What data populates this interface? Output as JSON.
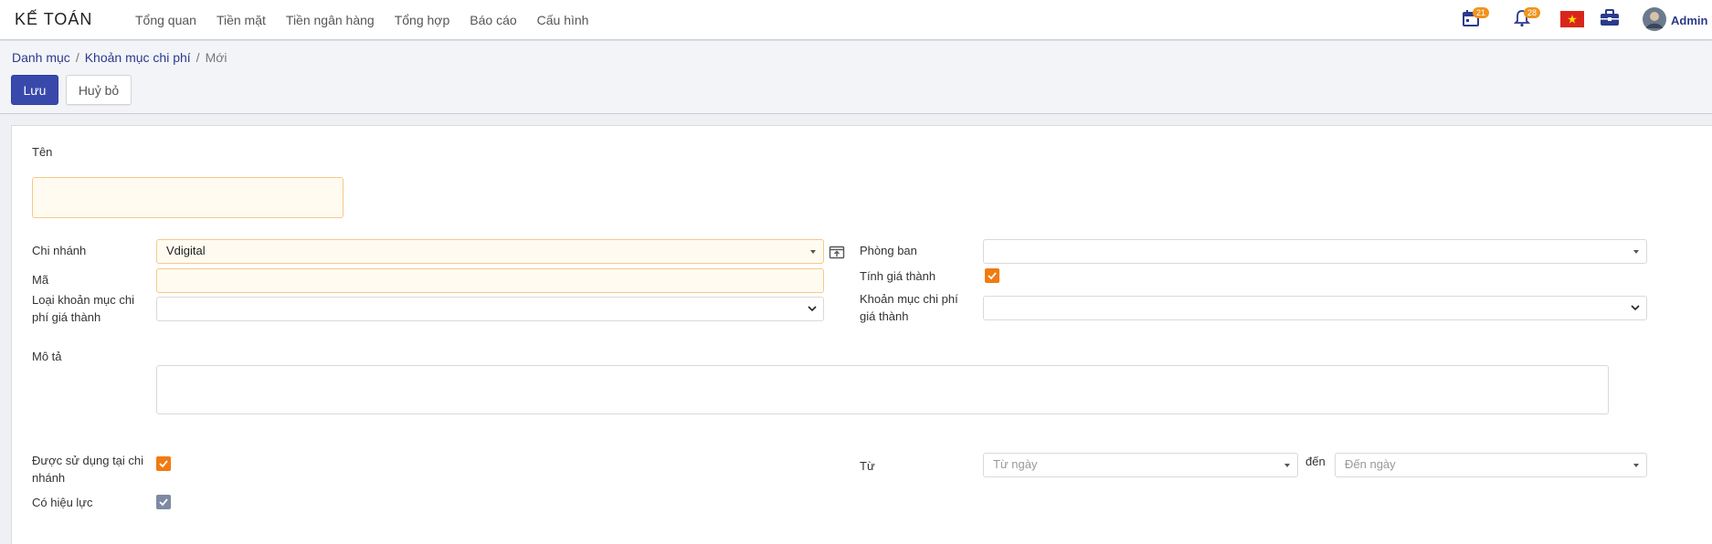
{
  "navbar": {
    "brand": "KẾ TOÁN",
    "menu": [
      "Tổng quan",
      "Tiền mặt",
      "Tiền ngân hàng",
      "Tổng hợp",
      "Báo cáo",
      "Cấu hình"
    ],
    "calendar_badge": "21",
    "notification_badge": "28",
    "user_name": "Admin"
  },
  "breadcrumb": {
    "level1": "Danh mục",
    "level2": "Khoản mục chi phí",
    "current": "Mới",
    "separator": "/"
  },
  "actions": {
    "save_label": "Lưu",
    "discard_label": "Huỷ bỏ"
  },
  "form": {
    "name_label": "Tên",
    "name_value": "",
    "branch_label": "Chi nhánh",
    "branch_value": "Vdigital",
    "code_label": "Mã",
    "code_value": "",
    "cost_type_label_line1": "Loại khoản mục chi",
    "cost_type_label_line2": "phí giá thành",
    "cost_type_value": "",
    "department_label": "Phòng ban",
    "department_value": "",
    "compute_cost_label": "Tính giá thành",
    "compute_cost_checked": true,
    "cost_item_label_line1": "Khoản mục chi phí",
    "cost_item_label_line2": "giá thành",
    "cost_item_value": "",
    "description_label": "Mô tả",
    "description_value": "",
    "used_in_branch_label_line1": "Được sử dụng tại chi",
    "used_in_branch_label_line2": "nhánh",
    "used_in_branch_checked": true,
    "active_label": "Có hiệu lực",
    "active_checked": true,
    "from_label": "Từ",
    "from_placeholder": "Từ ngày",
    "to_label": "đến",
    "to_placeholder": "Đến ngày"
  },
  "colors": {
    "primary": "#3949ab",
    "link": "#2b3a8c",
    "badge": "#f0931e",
    "checkbox": "#f07b12",
    "required_bg": "#fffbf1",
    "required_border": "#f7c989"
  }
}
